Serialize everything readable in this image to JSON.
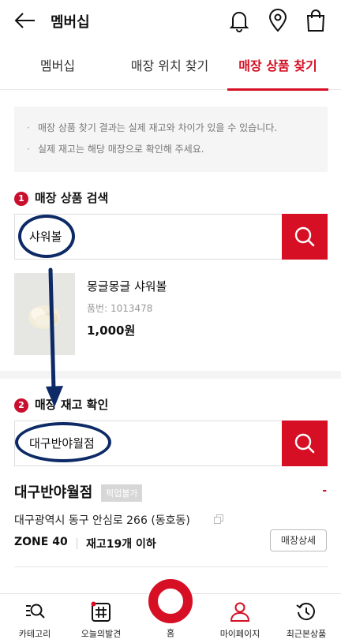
{
  "header": {
    "title": "멤버십",
    "back_icon": "arrow-left-icon",
    "icons": [
      "bell-icon",
      "location-pin-icon",
      "shopping-bag-icon"
    ]
  },
  "tabs": [
    {
      "label": "멤버십",
      "active": false
    },
    {
      "label": "매장 위치 찾기",
      "active": false
    },
    {
      "label": "매장 상품 찾기",
      "active": true
    }
  ],
  "notice": [
    "매장 상품 찾기 결과는 실제 재고와 차이가 있을 수 있습니다.",
    "실제 재고는 해당 매장으로 확인해 주세요."
  ],
  "product_search": {
    "step": "1",
    "title": "매장 상품 검색",
    "value": "샤워볼"
  },
  "product": {
    "name": "몽글몽글 샤워볼",
    "code": "품번: 1013478",
    "price": "1,000원"
  },
  "store_search": {
    "step": "2",
    "title": "매장 재고 확인",
    "value": "대구반야월점"
  },
  "store": {
    "name": "대구반야월점",
    "pickup_badge": "픽업불가",
    "status_mark": "-",
    "address": "대구광역시 동구 안심로 266 (동호동)",
    "zone": "ZONE 40",
    "stock": "재고19개 이하",
    "detail_button": "매장상세"
  },
  "bottom_nav": {
    "items": [
      {
        "label": "카테고리",
        "icon": "category-search-icon"
      },
      {
        "label": "오늘의발견",
        "icon": "hashtag-icon"
      },
      {
        "label": "홈",
        "icon": "home-circle-icon"
      },
      {
        "label": "마이페이지",
        "icon": "person-icon"
      },
      {
        "label": "최근본상품",
        "icon": "history-icon"
      }
    ]
  },
  "colors": {
    "accent": "#d60f24",
    "annotation": "#0d2a66"
  }
}
